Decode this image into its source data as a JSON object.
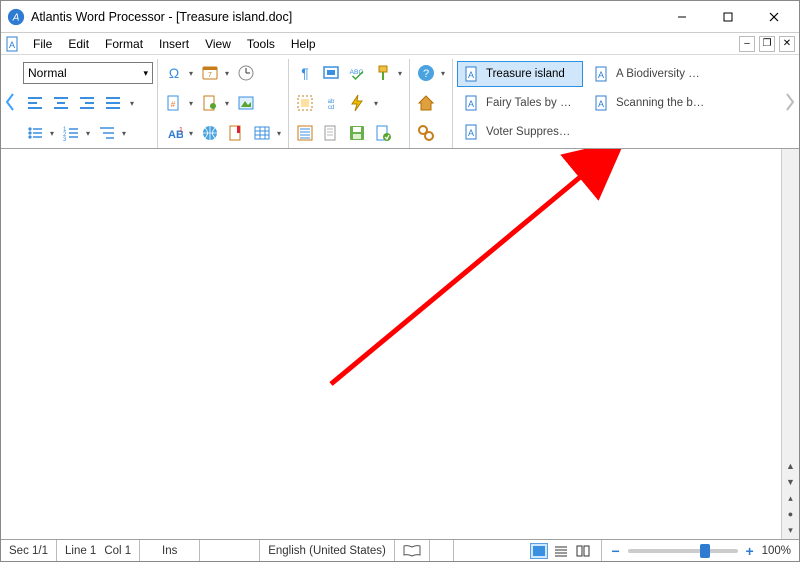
{
  "title": "Atlantis Word Processor - [Treasure island.doc]",
  "menu": {
    "items": [
      "File",
      "Edit",
      "Format",
      "Insert",
      "View",
      "Tools",
      "Help"
    ]
  },
  "style_selector": "Normal",
  "documents": {
    "col1": [
      {
        "label": "Treasure island",
        "active": true
      },
      {
        "label": "Fairy Tales by Ha…",
        "active": false
      },
      {
        "label": "Voter Suppression",
        "active": false
      }
    ],
    "col2": [
      {
        "label": "A Biodiversity Vi…",
        "active": false
      },
      {
        "label": "Scanning the bu…",
        "active": false
      }
    ]
  },
  "status": {
    "section": "Sec 1/1",
    "line": "Line 1",
    "col": "Col 1",
    "ins": "Ins",
    "lang": "English (United States)",
    "zoom": "100%"
  }
}
